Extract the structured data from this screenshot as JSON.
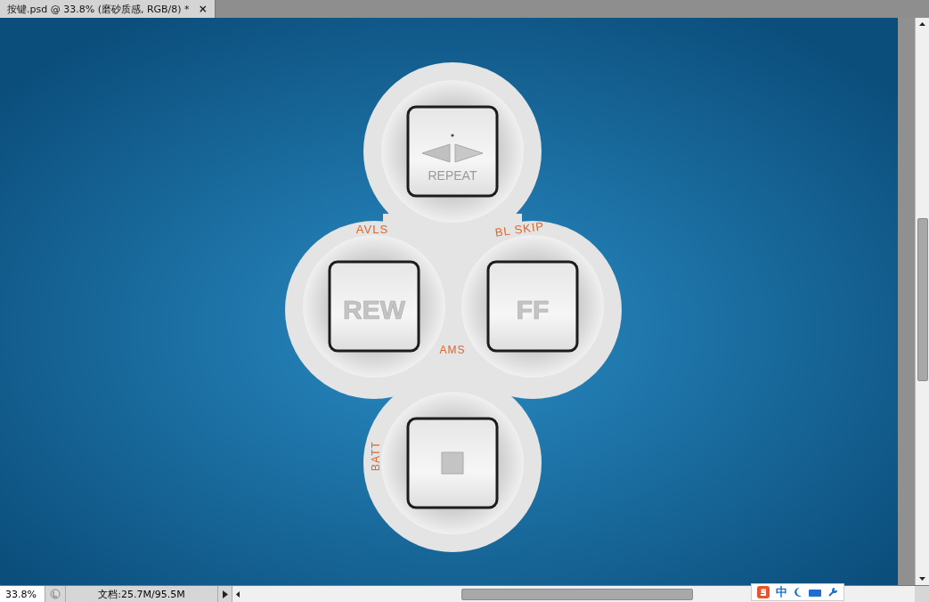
{
  "document_tab": {
    "title": "按键.psd @ 33.8% (磨砂质感, RGB/8) *",
    "close": "×"
  },
  "artwork": {
    "keys": [
      {
        "kind": "repeat",
        "label": "REPEAT"
      },
      {
        "kind": "text",
        "label": "REW"
      },
      {
        "kind": "text",
        "label": "FF"
      },
      {
        "kind": "stop"
      }
    ],
    "markings": [
      {
        "text": "AVLS"
      },
      {
        "text": "BL SKIP"
      },
      {
        "text": "AMS"
      },
      {
        "text": "BATT"
      }
    ]
  },
  "status_bar": {
    "zoom": "33.8%",
    "doc_info": "文档:25.7M/95.5M"
  },
  "ime_bar": {
    "mode": "中"
  }
}
